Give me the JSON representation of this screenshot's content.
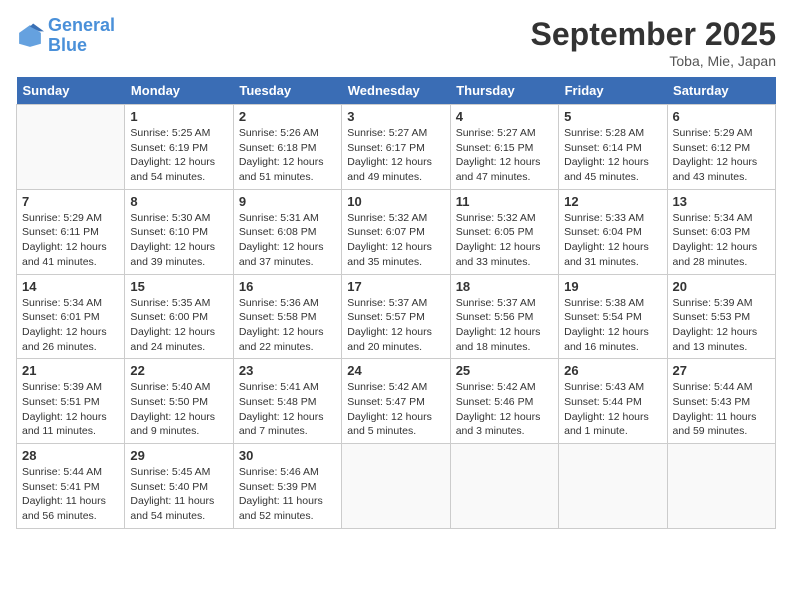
{
  "header": {
    "logo_line1": "General",
    "logo_line2": "Blue",
    "month": "September 2025",
    "location": "Toba, Mie, Japan"
  },
  "days": [
    "Sunday",
    "Monday",
    "Tuesday",
    "Wednesday",
    "Thursday",
    "Friday",
    "Saturday"
  ],
  "weeks": [
    [
      {
        "date": "",
        "info": ""
      },
      {
        "date": "1",
        "info": "Sunrise: 5:25 AM\nSunset: 6:19 PM\nDaylight: 12 hours\nand 54 minutes."
      },
      {
        "date": "2",
        "info": "Sunrise: 5:26 AM\nSunset: 6:18 PM\nDaylight: 12 hours\nand 51 minutes."
      },
      {
        "date": "3",
        "info": "Sunrise: 5:27 AM\nSunset: 6:17 PM\nDaylight: 12 hours\nand 49 minutes."
      },
      {
        "date": "4",
        "info": "Sunrise: 5:27 AM\nSunset: 6:15 PM\nDaylight: 12 hours\nand 47 minutes."
      },
      {
        "date": "5",
        "info": "Sunrise: 5:28 AM\nSunset: 6:14 PM\nDaylight: 12 hours\nand 45 minutes."
      },
      {
        "date": "6",
        "info": "Sunrise: 5:29 AM\nSunset: 6:12 PM\nDaylight: 12 hours\nand 43 minutes."
      }
    ],
    [
      {
        "date": "7",
        "info": "Sunrise: 5:29 AM\nSunset: 6:11 PM\nDaylight: 12 hours\nand 41 minutes."
      },
      {
        "date": "8",
        "info": "Sunrise: 5:30 AM\nSunset: 6:10 PM\nDaylight: 12 hours\nand 39 minutes."
      },
      {
        "date": "9",
        "info": "Sunrise: 5:31 AM\nSunset: 6:08 PM\nDaylight: 12 hours\nand 37 minutes."
      },
      {
        "date": "10",
        "info": "Sunrise: 5:32 AM\nSunset: 6:07 PM\nDaylight: 12 hours\nand 35 minutes."
      },
      {
        "date": "11",
        "info": "Sunrise: 5:32 AM\nSunset: 6:05 PM\nDaylight: 12 hours\nand 33 minutes."
      },
      {
        "date": "12",
        "info": "Sunrise: 5:33 AM\nSunset: 6:04 PM\nDaylight: 12 hours\nand 31 minutes."
      },
      {
        "date": "13",
        "info": "Sunrise: 5:34 AM\nSunset: 6:03 PM\nDaylight: 12 hours\nand 28 minutes."
      }
    ],
    [
      {
        "date": "14",
        "info": "Sunrise: 5:34 AM\nSunset: 6:01 PM\nDaylight: 12 hours\nand 26 minutes."
      },
      {
        "date": "15",
        "info": "Sunrise: 5:35 AM\nSunset: 6:00 PM\nDaylight: 12 hours\nand 24 minutes."
      },
      {
        "date": "16",
        "info": "Sunrise: 5:36 AM\nSunset: 5:58 PM\nDaylight: 12 hours\nand 22 minutes."
      },
      {
        "date": "17",
        "info": "Sunrise: 5:37 AM\nSunset: 5:57 PM\nDaylight: 12 hours\nand 20 minutes."
      },
      {
        "date": "18",
        "info": "Sunrise: 5:37 AM\nSunset: 5:56 PM\nDaylight: 12 hours\nand 18 minutes."
      },
      {
        "date": "19",
        "info": "Sunrise: 5:38 AM\nSunset: 5:54 PM\nDaylight: 12 hours\nand 16 minutes."
      },
      {
        "date": "20",
        "info": "Sunrise: 5:39 AM\nSunset: 5:53 PM\nDaylight: 12 hours\nand 13 minutes."
      }
    ],
    [
      {
        "date": "21",
        "info": "Sunrise: 5:39 AM\nSunset: 5:51 PM\nDaylight: 12 hours\nand 11 minutes."
      },
      {
        "date": "22",
        "info": "Sunrise: 5:40 AM\nSunset: 5:50 PM\nDaylight: 12 hours\nand 9 minutes."
      },
      {
        "date": "23",
        "info": "Sunrise: 5:41 AM\nSunset: 5:48 PM\nDaylight: 12 hours\nand 7 minutes."
      },
      {
        "date": "24",
        "info": "Sunrise: 5:42 AM\nSunset: 5:47 PM\nDaylight: 12 hours\nand 5 minutes."
      },
      {
        "date": "25",
        "info": "Sunrise: 5:42 AM\nSunset: 5:46 PM\nDaylight: 12 hours\nand 3 minutes."
      },
      {
        "date": "26",
        "info": "Sunrise: 5:43 AM\nSunset: 5:44 PM\nDaylight: 12 hours\nand 1 minute."
      },
      {
        "date": "27",
        "info": "Sunrise: 5:44 AM\nSunset: 5:43 PM\nDaylight: 11 hours\nand 59 minutes."
      }
    ],
    [
      {
        "date": "28",
        "info": "Sunrise: 5:44 AM\nSunset: 5:41 PM\nDaylight: 11 hours\nand 56 minutes."
      },
      {
        "date": "29",
        "info": "Sunrise: 5:45 AM\nSunset: 5:40 PM\nDaylight: 11 hours\nand 54 minutes."
      },
      {
        "date": "30",
        "info": "Sunrise: 5:46 AM\nSunset: 5:39 PM\nDaylight: 11 hours\nand 52 minutes."
      },
      {
        "date": "",
        "info": ""
      },
      {
        "date": "",
        "info": ""
      },
      {
        "date": "",
        "info": ""
      },
      {
        "date": "",
        "info": ""
      }
    ]
  ]
}
